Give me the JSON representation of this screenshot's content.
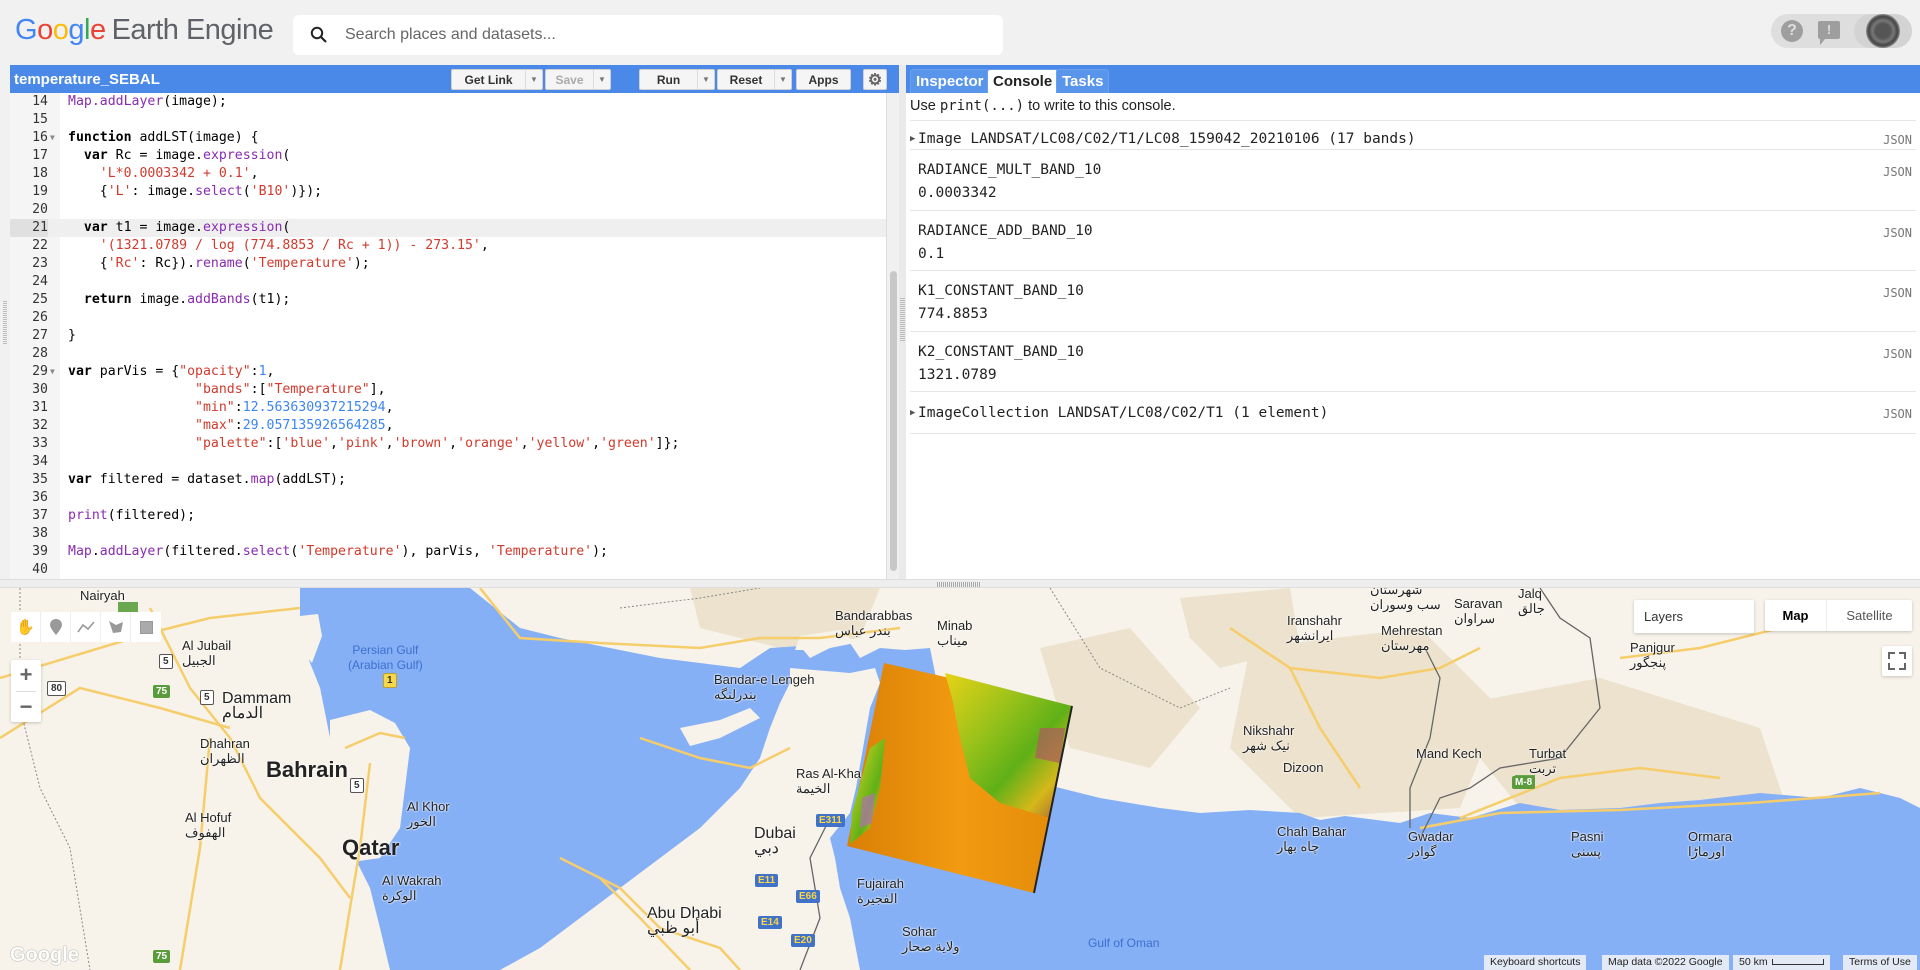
{
  "app": {
    "logo_google": [
      "G",
      "o",
      "o",
      "g",
      "l",
      "e"
    ],
    "logo_product": "Earth Engine"
  },
  "search": {
    "placeholder": "Search places and datasets...",
    "value": ""
  },
  "header_icons": {
    "help": "?",
    "feedback": "!",
    "avatar": "account-avatar"
  },
  "editor": {
    "script_title": "temperature_SEBAL",
    "buttons": {
      "get_link": "Get Link",
      "save": "Save",
      "run": "Run",
      "reset": "Reset",
      "apps": "Apps",
      "settings_icon": "⚙"
    },
    "active_line": 21,
    "lines": [
      {
        "n": "14",
        "fold": false,
        "html": "<span class=\"fn\">Map</span><span class=\"fn\">.addLayer</span>(image);"
      },
      {
        "n": "15",
        "fold": false,
        "html": ""
      },
      {
        "n": "16",
        "fold": true,
        "html": "<span class=\"kw\">function</span> addLST(image) {"
      },
      {
        "n": "17",
        "fold": false,
        "html": "  <span class=\"kw\">var</span> Rc = image.<span class=\"fn\">expression</span>("
      },
      {
        "n": "18",
        "fold": false,
        "html": "    <span class=\"st\">'L*0.0003342 + 0.1'</span>,"
      },
      {
        "n": "19",
        "fold": false,
        "html": "    {<span class=\"st\">'L'</span>: image.<span class=\"fn\">select</span>(<span class=\"st\">'B10'</span>)});"
      },
      {
        "n": "20",
        "fold": false,
        "html": ""
      },
      {
        "n": "21",
        "fold": false,
        "html": "  <span class=\"kw\">var</span> t1 = image.<span class=\"fn\">expression</span>("
      },
      {
        "n": "22",
        "fold": false,
        "html": "    <span class=\"st\">'(1321.0789 / log (774.8853 / Rc + 1)) - 273.15'</span>,"
      },
      {
        "n": "23",
        "fold": false,
        "html": "    {<span class=\"st\">'Rc'</span>: Rc}).<span class=\"fn\">rename</span>(<span class=\"st\">'Temperature'</span>);"
      },
      {
        "n": "24",
        "fold": false,
        "html": ""
      },
      {
        "n": "25",
        "fold": false,
        "html": "  <span class=\"kw\">return</span> image.<span class=\"fn\">addBands</span>(t1);"
      },
      {
        "n": "26",
        "fold": false,
        "html": ""
      },
      {
        "n": "27",
        "fold": false,
        "html": "}"
      },
      {
        "n": "28",
        "fold": false,
        "html": ""
      },
      {
        "n": "29",
        "fold": true,
        "html": "<span class=\"kw\">var</span> parVis = {<span class=\"st\">\"opacity\"</span>:<span class=\"nm\">1</span>,"
      },
      {
        "n": "30",
        "fold": false,
        "html": "                <span class=\"st\">\"bands\"</span>:[<span class=\"st\">\"Temperature\"</span>],"
      },
      {
        "n": "31",
        "fold": false,
        "html": "                <span class=\"st\">\"min\"</span>:<span class=\"nm\">12.563630937215294</span>,"
      },
      {
        "n": "32",
        "fold": false,
        "html": "                <span class=\"st\">\"max\"</span>:<span class=\"nm\">29.057135926564285</span>,"
      },
      {
        "n": "33",
        "fold": false,
        "html": "                <span class=\"st\">\"palette\"</span>:[<span class=\"st\">'blue'</span>,<span class=\"st\">'pink'</span>,<span class=\"st\">'brown'</span>,<span class=\"st\">'orange'</span>,<span class=\"st\">'yellow'</span>,<span class=\"st\">'green'</span>]};"
      },
      {
        "n": "34",
        "fold": false,
        "html": ""
      },
      {
        "n": "35",
        "fold": false,
        "html": "<span class=\"kw\">var</span> filtered = dataset.<span class=\"fn\">map</span>(addLST);"
      },
      {
        "n": "36",
        "fold": false,
        "html": ""
      },
      {
        "n": "37",
        "fold": false,
        "html": "<span class=\"fn\">print</span>(filtered);"
      },
      {
        "n": "38",
        "fold": false,
        "html": ""
      },
      {
        "n": "39",
        "fold": false,
        "html": "<span class=\"fn\">Map</span>.<span class=\"fn\">addLayer</span>(filtered.<span class=\"fn\">select</span>(<span class=\"st\">'Temperature'</span>), parVis, <span class=\"st\">'Temperature'</span>);"
      },
      {
        "n": "40",
        "fold": false,
        "html": ""
      }
    ]
  },
  "console": {
    "tabs": [
      {
        "label": "Inspector",
        "active": false
      },
      {
        "label": "Console",
        "active": true
      },
      {
        "label": "Tasks",
        "active": false
      }
    ],
    "hint_pre": "Use ",
    "hint_code": "print(...)",
    "hint_post": " to write to this console.",
    "json_label": "JSON",
    "entries": [
      {
        "type": "collapsible",
        "text": "Image LANDSAT/LC08/C02/T1/LC08_159042_20210106 (17 bands)"
      },
      {
        "type": "kv",
        "key": "RADIANCE_MULT_BAND_10",
        "value": "0.0003342"
      },
      {
        "type": "kv",
        "key": "RADIANCE_ADD_BAND_10",
        "value": "0.1"
      },
      {
        "type": "kv",
        "key": "K1_CONSTANT_BAND_10",
        "value": "774.8853"
      },
      {
        "type": "kv",
        "key": "K2_CONSTANT_BAND_10",
        "value": "1321.0789"
      },
      {
        "type": "collapsible",
        "text": "ImageCollection LANDSAT/LC08/C02/T1 (1 element)"
      }
    ]
  },
  "map": {
    "layers_label": "Layers",
    "map_type": {
      "map": "Map",
      "satellite": "Satellite",
      "selected": "Map"
    },
    "zoom_in": "+",
    "zoom_out": "−",
    "draw_tools": [
      "hand-pan",
      "point-marker",
      "line",
      "polygon",
      "rectangle"
    ],
    "watermark": "Google",
    "footer": {
      "shortcuts": "Keyboard shortcuts",
      "map_data": "Map data ©2022 Google",
      "scale": "50 km",
      "terms": "Terms of Use"
    },
    "labels": [
      {
        "id": "nairyah",
        "en": "Nairyah",
        "ar": ""
      },
      {
        "id": "al-jubail",
        "en": "Al Jubail",
        "ar": "الجبيل"
      },
      {
        "id": "dammam",
        "en": "Dammam",
        "ar": "الدمام"
      },
      {
        "id": "dhahran",
        "en": "Dhahran",
        "ar": "الظهران"
      },
      {
        "id": "bahrain",
        "en": "Bahrain",
        "ar": ""
      },
      {
        "id": "al-hofuf",
        "en": "Al Hofuf",
        "ar": "الهفوف"
      },
      {
        "id": "qatar",
        "en": "Qatar",
        "ar": ""
      },
      {
        "id": "al-khor",
        "en": "Al Khor",
        "ar": "الخور"
      },
      {
        "id": "al-wakrah",
        "en": "Al Wakrah",
        "ar": "الوكرة"
      },
      {
        "id": "persian-gulf",
        "en": "Persian Gulf",
        "ar": "(Arabian Gulf)"
      },
      {
        "id": "bandarabbas",
        "en": "Bandarabbas",
        "ar": "بندر عباس"
      },
      {
        "id": "minab",
        "en": "Minab",
        "ar": "میناب"
      },
      {
        "id": "bandar-e-lengeh",
        "en": "Bandar-e Lengeh",
        "ar": "بندرلنگه"
      },
      {
        "id": "ras-al-khaimah",
        "en": "Ras Al-Kha",
        "ar": "الخيمة"
      },
      {
        "id": "dubai",
        "en": "Dubai",
        "ar": "دبي"
      },
      {
        "id": "fujairah",
        "en": "Fujairah",
        "ar": "الفجيرة"
      },
      {
        "id": "abu-dhabi",
        "en": "Abu Dhabi",
        "ar": "أبو ظبي"
      },
      {
        "id": "sohar",
        "en": "Sohar",
        "ar": "ولاية صحار"
      },
      {
        "id": "gulf-of-oman",
        "en": "Gulf of Oman",
        "ar": ""
      },
      {
        "id": "iranshahr",
        "en": "Iranshahr",
        "ar": "ایرانشهر"
      },
      {
        "id": "mehrestan",
        "en": "Mehrestan",
        "ar": "مهرستان"
      },
      {
        "id": "saravan",
        "en": "Saravan",
        "ar": "سراوان"
      },
      {
        "id": "jalq",
        "en": "Jalq",
        "ar": "جالق"
      },
      {
        "id": "sib-suran",
        "en": "شهرستان",
        "ar": "سب وسوران"
      },
      {
        "id": "panjgur",
        "en": "Panjgur",
        "ar": "پنجگور"
      },
      {
        "id": "nikshahr",
        "en": "Nikshahr",
        "ar": "نیک شهر"
      },
      {
        "id": "dizoon",
        "en": "Dizoon",
        "ar": ""
      },
      {
        "id": "mand-kech",
        "en": "Mand Kech",
        "ar": ""
      },
      {
        "id": "turbat",
        "en": "Turbat",
        "ar": "تربت"
      },
      {
        "id": "chah-bahar",
        "en": "Chah Bahar",
        "ar": "چاه بهار"
      },
      {
        "id": "gwadar",
        "en": "Gwadar",
        "ar": "گوادر"
      },
      {
        "id": "pasni",
        "en": "Pasni",
        "ar": "پسنی"
      },
      {
        "id": "ormara",
        "en": "Ormara",
        "ar": "اورماڑا"
      }
    ],
    "shields": [
      {
        "id": "r5a",
        "text": "5",
        "style": "w"
      },
      {
        "id": "r5b",
        "text": "5",
        "style": "w"
      },
      {
        "id": "r75a",
        "text": "75",
        "style": "g"
      },
      {
        "id": "r75b",
        "text": "75",
        "style": "g"
      },
      {
        "id": "r80",
        "text": "80",
        "style": "w"
      },
      {
        "id": "r1",
        "text": "1",
        "style": "y"
      },
      {
        "id": "r5c",
        "text": "5",
        "style": "w"
      },
      {
        "id": "e311",
        "text": "E311",
        "style": "e"
      },
      {
        "id": "e11",
        "text": "E11",
        "style": "e"
      },
      {
        "id": "e66",
        "text": "E66",
        "style": "e"
      },
      {
        "id": "e14",
        "text": "E14",
        "style": "e"
      },
      {
        "id": "e20",
        "text": "E20",
        "style": "e"
      },
      {
        "id": "m8",
        "text": "M-8",
        "style": "g"
      }
    ],
    "colors": {
      "water": "#86b0f5",
      "land": "#f7f3ea",
      "relief": "#ece2cd",
      "accent": "#4a89e8"
    },
    "layer": {
      "name": "Temperature",
      "palette": [
        "blue",
        "pink",
        "brown",
        "orange",
        "yellow",
        "green"
      ],
      "min": 12.563630937215294,
      "max": 29.057135926564285
    }
  }
}
